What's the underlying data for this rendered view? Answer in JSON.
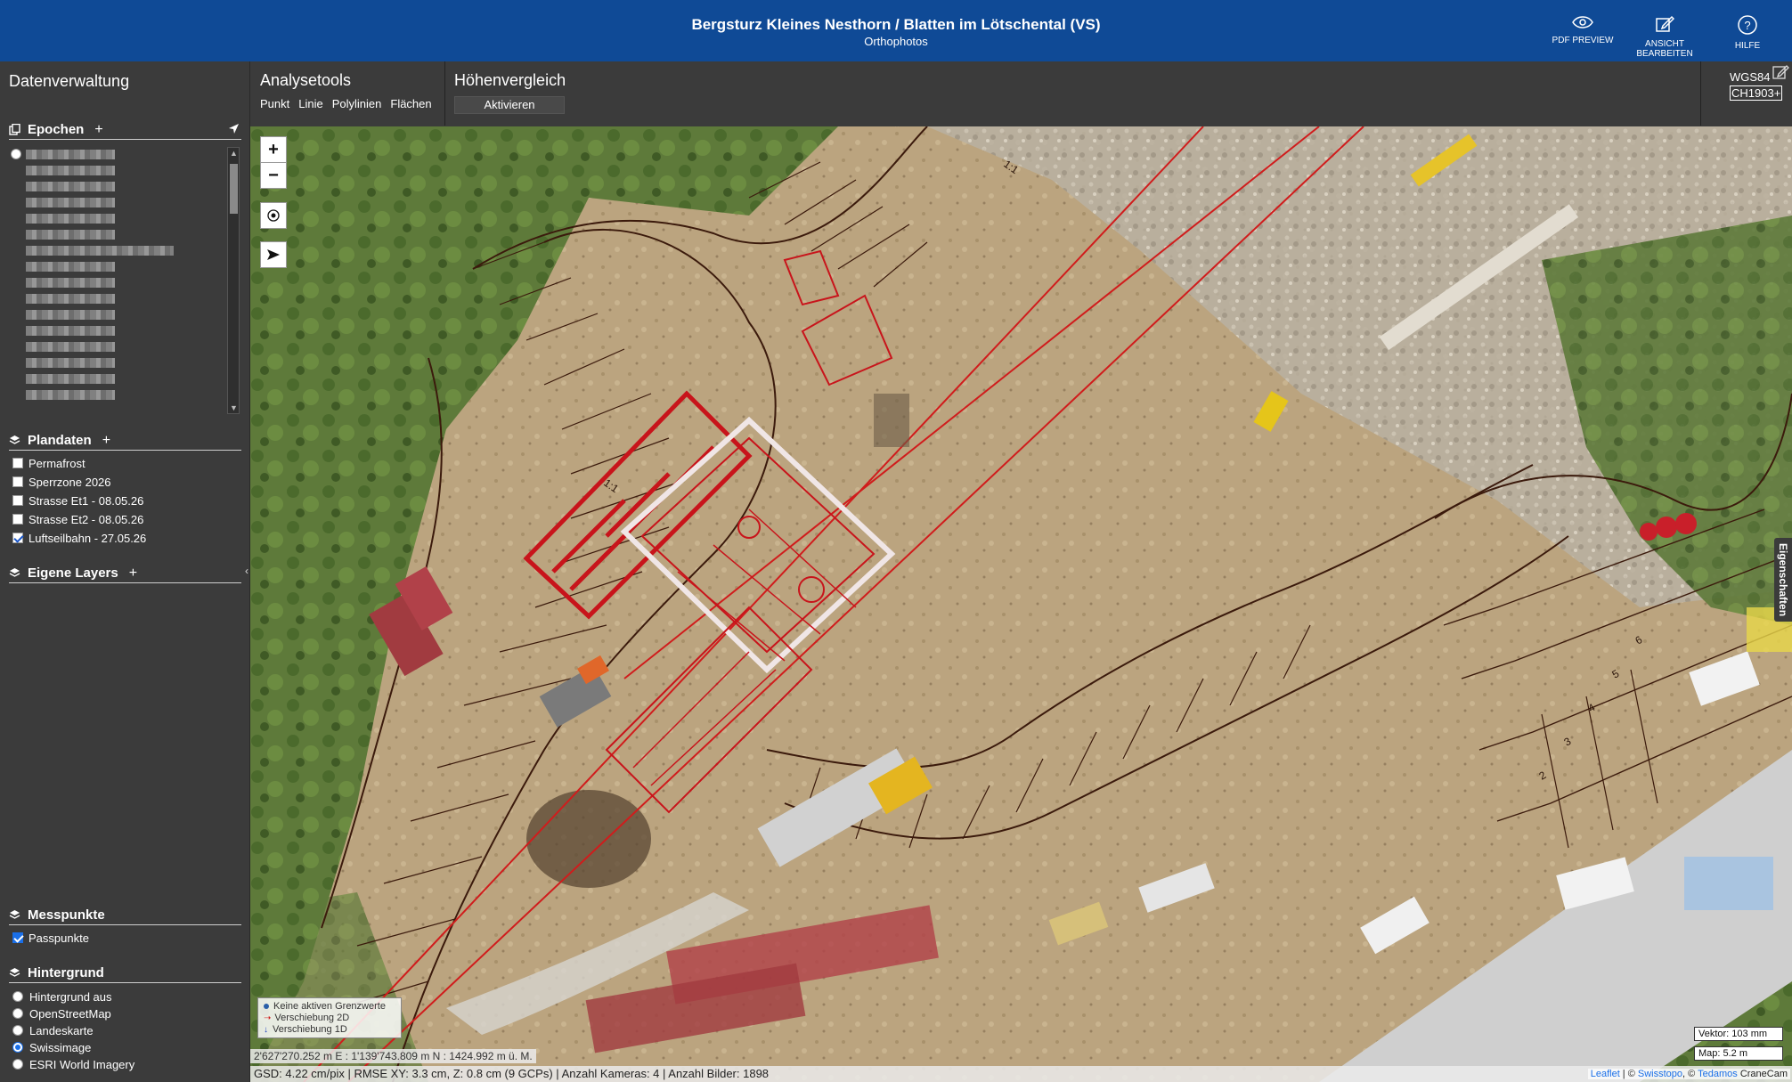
{
  "header": {
    "title": "Bergsturz Kleines Nesthorn / Blatten im Lötschental (VS)",
    "subtitle": "Orthophotos",
    "buttons": [
      {
        "label": "PDF PREVIEW",
        "icon": "eye-icon"
      },
      {
        "label": "ANSICHT BEARBEITEN",
        "icon": "edit-icon"
      },
      {
        "label": "HILFE",
        "icon": "help-icon"
      }
    ]
  },
  "sidebar": {
    "title": "Datenverwaltung",
    "epochs": {
      "label": "Epochen",
      "add": "+"
    },
    "plandata": {
      "label": "Plandaten",
      "add": "+",
      "items": [
        {
          "label": "Permafrost",
          "checked": false
        },
        {
          "label": "Sperrzone 2026",
          "checked": false
        },
        {
          "label": "Strasse Et1 - 08.05.26",
          "checked": false
        },
        {
          "label": "Strasse Et2 - 08.05.26",
          "checked": false
        },
        {
          "label": "Luftseilbahn - 27.05.26",
          "checked": true
        }
      ]
    },
    "own_layers": {
      "label": "Eigene Layers",
      "add": "+"
    },
    "messpunkte": {
      "label": "Messpunkte",
      "items": [
        {
          "label": "Passpunkte",
          "checked": true
        }
      ]
    },
    "background": {
      "label": "Hintergrund",
      "items": [
        {
          "label": "Hintergrund aus",
          "selected": false
        },
        {
          "label": "OpenStreetMap",
          "selected": false
        },
        {
          "label": "Landeskarte",
          "selected": false
        },
        {
          "label": "Swissimage",
          "selected": true
        },
        {
          "label": "ESRI World Imagery",
          "selected": false
        }
      ]
    }
  },
  "toolbar": {
    "analysis": {
      "title": "Analysetools",
      "items": [
        "Punkt",
        "Linie",
        "Polylinien",
        "Flächen"
      ]
    },
    "height": {
      "title": "Höhenvergleich",
      "button": "Aktivieren"
    },
    "crs": {
      "wgs": "WGS84",
      "ch": "CH1903+"
    }
  },
  "map": {
    "zoom_in": "+",
    "zoom_out": "−",
    "legend": [
      {
        "label": "Keine aktiven Grenzwerte",
        "color": "#2a5fa8"
      },
      {
        "label": "Verschiebung 2D",
        "color": "#d01c1c"
      },
      {
        "label": "Verschiebung 1D",
        "color": "#1a3fbf"
      }
    ],
    "coordinates": "2'627'270.252 m E : 1'139'743.809 m N : 1424.992 m ü. M.",
    "status": "GSD: 4.22 cm/pix | RMSE XY: 3.3 cm, Z: 0.8 cm (9 GCPs) | Anzahl Kameras: 4 | Anzahl Bilder: 1898",
    "scale_vector": "Vektor: 103 mm",
    "scale_map": "Map: 5.2 m",
    "attribution": {
      "leaflet": "Leaflet",
      "swisstopo": "Swisstopo",
      "tedamos": "Tedamos",
      "cranecam": "CraneCam"
    },
    "properties_tab": "Eigenschaften",
    "slope_label": "1:1",
    "slope_label_2": "1:1",
    "marker_numbers": [
      "6",
      "5",
      "4",
      "3",
      "2"
    ],
    "colors": {
      "plan_red": "#c8141b",
      "hatch": "#3b1a0c",
      "accent": "#0f4a96"
    }
  }
}
